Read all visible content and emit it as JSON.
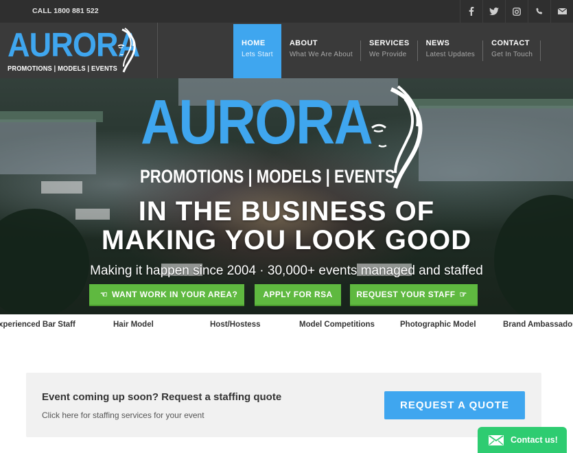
{
  "topbar": {
    "phone": "CALL 1800 881 522",
    "social": [
      {
        "icon": "facebook-icon"
      },
      {
        "icon": "twitter-icon"
      },
      {
        "icon": "instagram-icon"
      },
      {
        "icon": "phone-icon"
      },
      {
        "icon": "email-icon"
      }
    ]
  },
  "logo": {
    "word": "AURORA",
    "tagline": "PROMOTIONS | MODELS | EVENTS"
  },
  "nav": {
    "items": [
      {
        "title": "HOME",
        "subtitle": "Lets Start",
        "active": true
      },
      {
        "title": "ABOUT",
        "subtitle": "What We Are About",
        "active": false
      },
      {
        "title": "SERVICES",
        "subtitle": "We Provide",
        "active": false
      },
      {
        "title": "NEWS",
        "subtitle": "Latest Updates",
        "active": false
      },
      {
        "title": "CONTACT",
        "subtitle": "Get In Touch",
        "active": false
      }
    ]
  },
  "hero": {
    "logo_word": "AURORA",
    "logo_tagline": "PROMOTIONS | MODELS | EVENTS",
    "headline_1": "IN THE BUSINESS OF",
    "headline_2": "MAKING YOU LOOK GOOD",
    "subheadline": "Making it happen since 2004 · 30,000+ events managed and staffed",
    "buttons": {
      "work": "WANT WORK IN YOUR AREA?",
      "rsa": "APPLY FOR RSA",
      "staff": "REQUEST YOUR STAFF"
    }
  },
  "categories": [
    "xperienced Bar Staff",
    "Hair Model",
    "Host/Hostess",
    "Model Competitions",
    "Photographic Model",
    "Brand Ambassador"
  ],
  "quote": {
    "heading": "Event coming up soon? Request a staffing quote",
    "text": "Click here for staffing services for your event",
    "button": "REQUEST A QUOTE"
  },
  "contact_widget": {
    "label": "Contact us!"
  },
  "colors": {
    "accent_blue": "#3fa6ef",
    "button_green": "#5fb940",
    "contact_green": "#2ecc71",
    "header_dark": "#3a3a3a",
    "topbar_dark": "#2f2f2f"
  }
}
